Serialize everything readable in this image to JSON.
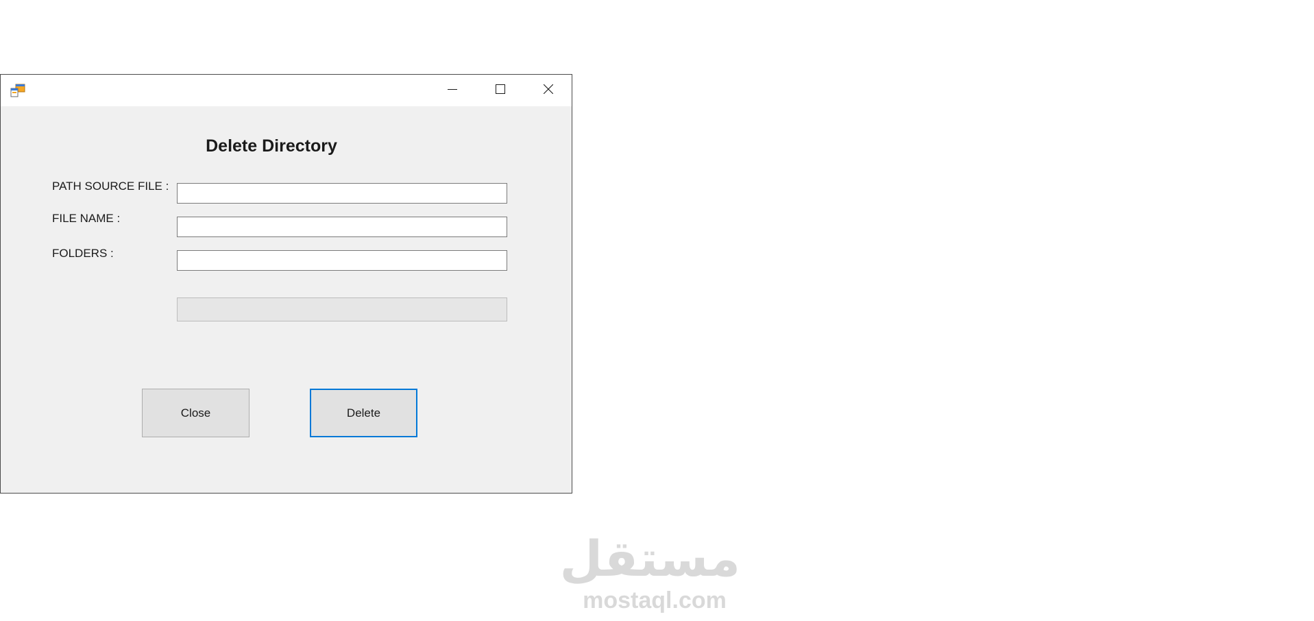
{
  "window": {
    "title": "",
    "controls": {
      "minimize": "minimize-icon",
      "maximize": "maximize-icon",
      "close": "close-icon"
    }
  },
  "form": {
    "heading": "Delete Directory",
    "fields": {
      "path_source_label": "PATH SOURCE FILE :",
      "path_source_value": "",
      "file_name_label": "FILE NAME :",
      "file_name_value": "",
      "folders_label": "FOLDERS :",
      "folders_value": ""
    },
    "progress": 0,
    "buttons": {
      "close_label": "Close",
      "delete_label": "Delete"
    }
  },
  "watermark": {
    "arabic": "مستقل",
    "latin": "mostaql.com"
  },
  "colors": {
    "focus_border": "#0078d7",
    "client_bg": "#f0f0f0",
    "button_bg": "#e1e1e1",
    "watermark": "#d9d9d9"
  }
}
